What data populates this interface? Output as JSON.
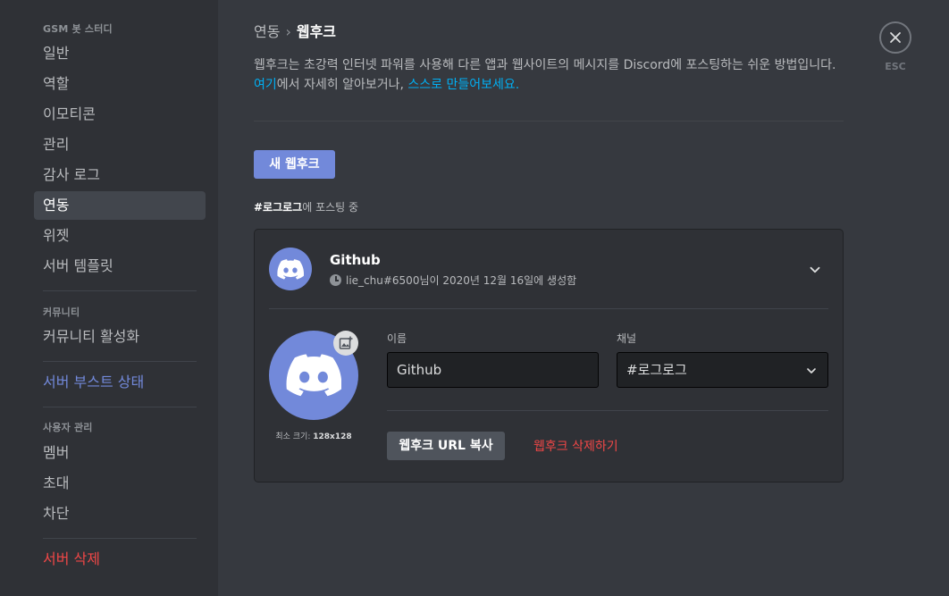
{
  "sidebar": {
    "server_header": "GSM 봇 스터디",
    "items_main": [
      "일반",
      "역할",
      "이모티콘",
      "관리",
      "감사 로그",
      "연동",
      "위젯",
      "서버 템플릿"
    ],
    "active_item": "연동",
    "community_header": "커뮤니티",
    "community_item": "커뮤니티 활성화",
    "boost_item": "서버 부스트 상태",
    "user_mgmt_header": "사용자 관리",
    "user_items": [
      "멤버",
      "초대",
      "차단"
    ],
    "delete_server": "서버 삭제"
  },
  "breadcrumb": {
    "parent": "연동",
    "current": "웹후크"
  },
  "description": {
    "text1": "웹후크는 초강력 인터넷 파워를 사용해 다른 앱과 웹사이트의 메시지를 Discord에 포스팅하는 쉬운 방법입니다. ",
    "link1": "여기",
    "text2": "에서 자세히 알아보거나, ",
    "link2": "스스로 만들어보세요."
  },
  "new_webhook_button": "새 웹후크",
  "posting": {
    "channel": "#로그로그",
    "suffix": "에 포스팅 중"
  },
  "webhook": {
    "name": "Github",
    "meta": "lie_chu#6500님이 2020년 12월 16일에 생성함",
    "name_label": "이름",
    "name_value": "Github",
    "channel_label": "채널",
    "channel_value": "#로그로그",
    "min_size_label": "최소 크기: ",
    "min_size_value": "128x128",
    "copy_url_button": "웹후크 URL 복사",
    "delete_button": "웹후크 삭제하기"
  },
  "close": {
    "esc_label": "ESC"
  },
  "colors": {
    "accent": "#7289da",
    "danger": "#f04747",
    "link": "#00b0f4"
  }
}
